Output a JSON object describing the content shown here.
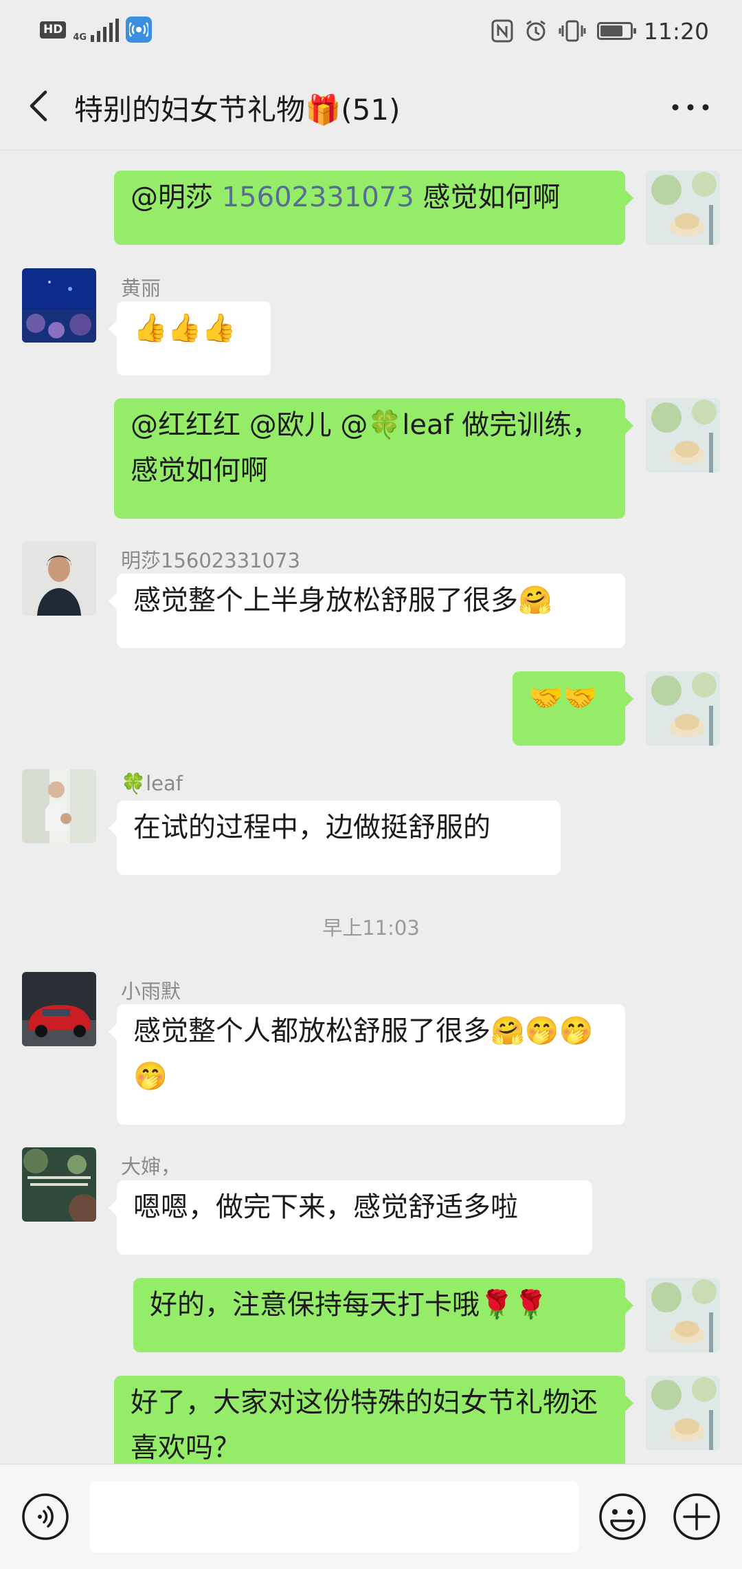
{
  "status_bar": {
    "hd_label": "HD",
    "network": "4G",
    "time": "11:20",
    "battery_level": 0.75,
    "icons": [
      "nfc-icon",
      "alarm-icon",
      "vibrate-icon",
      "battery-icon"
    ]
  },
  "header": {
    "title": "特别的妇女节礼物🎁(51)",
    "back_icon": "chevron-left-icon",
    "more_icon": "more-dots-icon"
  },
  "messages": [
    {
      "side": "right",
      "parts": {
        "a": "@明莎 ",
        "num": "15602331073",
        "b": " 感觉如何啊"
      }
    },
    {
      "side": "left",
      "sender": "黄丽",
      "emoji": "👍👍👍"
    },
    {
      "side": "right",
      "text": "@红红红 @欧儿 @🍀leaf 做完训练，感觉如何啊"
    },
    {
      "side": "left",
      "sender": "明莎15602331073",
      "text": "感觉整个上半身放松舒服了很多🤗"
    },
    {
      "side": "right",
      "emoji": "🤝🤝"
    },
    {
      "side": "left",
      "sender": "🍀leaf",
      "text": "在试的过程中，边做挺舒服的"
    },
    {
      "timestamp": "早上11:03"
    },
    {
      "side": "left",
      "sender": "小雨默",
      "text": "感觉整个人都放松舒服了很多🤗🤭🤭🤭"
    },
    {
      "side": "left",
      "sender": "大婶，",
      "text": "嗯嗯，做完下来，感觉舒适多啦"
    },
    {
      "side": "right",
      "text": "好的，注意保持每天打卡哦🌹🌹"
    },
    {
      "side": "right",
      "text": "好了，大家对这份特殊的妇女节礼物还喜欢吗？"
    }
  ],
  "input_bar": {
    "voice_icon": "voice-icon",
    "emoji_icon": "emoji-icon",
    "plus_icon": "plus-icon",
    "input_value": ""
  },
  "colors": {
    "background": "#ededed",
    "bubble_self": "#95ec69",
    "bubble_other": "#ffffff",
    "mention_link": "#576b95"
  }
}
